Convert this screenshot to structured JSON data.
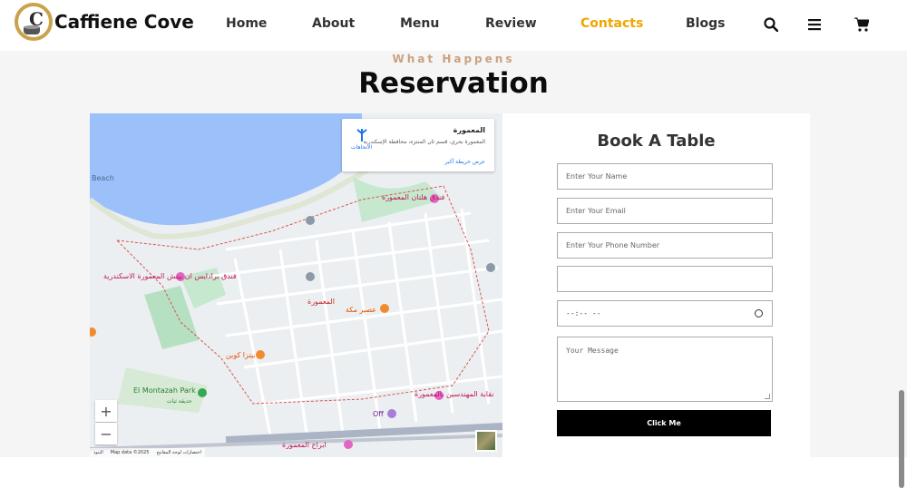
{
  "brand": {
    "name": "Caffiene Cove",
    "logo_letter": "C"
  },
  "nav": {
    "links": [
      {
        "label": "Home",
        "active": false
      },
      {
        "label": "About",
        "active": false
      },
      {
        "label": "Menu",
        "active": false
      },
      {
        "label": "Review",
        "active": false
      },
      {
        "label": "Contacts",
        "active": true
      },
      {
        "label": "Blogs",
        "active": false
      }
    ],
    "icons": [
      "search-icon",
      "menu-icon",
      "cart-icon"
    ],
    "active_color": "#f0a500"
  },
  "section": {
    "eyebrow": "What Happens",
    "title": "Reservation"
  },
  "map": {
    "info": {
      "title": "المعمورة",
      "subtitle": "المعمورة بحري، قسم ثان المنتزه، محافظة الإسكندرية",
      "directions_label": "الاتجاهات",
      "larger_map_link": "عرض خريطة أكبر"
    },
    "labels": {
      "beach": "Beach",
      "park": "El Montazah Park",
      "park_ar": "حديقة ثبات",
      "district": "المعمورة",
      "off": "Off",
      "hilton": "فندق هلتان المعمورة",
      "paradise": "فندق برادايس ان بيتش المعمورة الاسكندرية",
      "pizza": "بيتزا كوين",
      "juice": "عصير مكة",
      "engineers": "نقابة المهندسين بالمعمورة",
      "towers": "ابراج المعمورة"
    },
    "zoom_in": "+",
    "zoom_out": "−",
    "attribution": [
      "اختصارات لوحة المفاتيح",
      "Map data ©2025",
      "البنود"
    ]
  },
  "form": {
    "title": "Book A Table",
    "name_placeholder": "Enter Your Name",
    "email_placeholder": "Enter Your Email",
    "phone_placeholder": "Enter Your Phone Number",
    "date_value": "",
    "time_value": "--:-- --",
    "message_placeholder": "Your Message",
    "submit_label": "Click Me"
  }
}
